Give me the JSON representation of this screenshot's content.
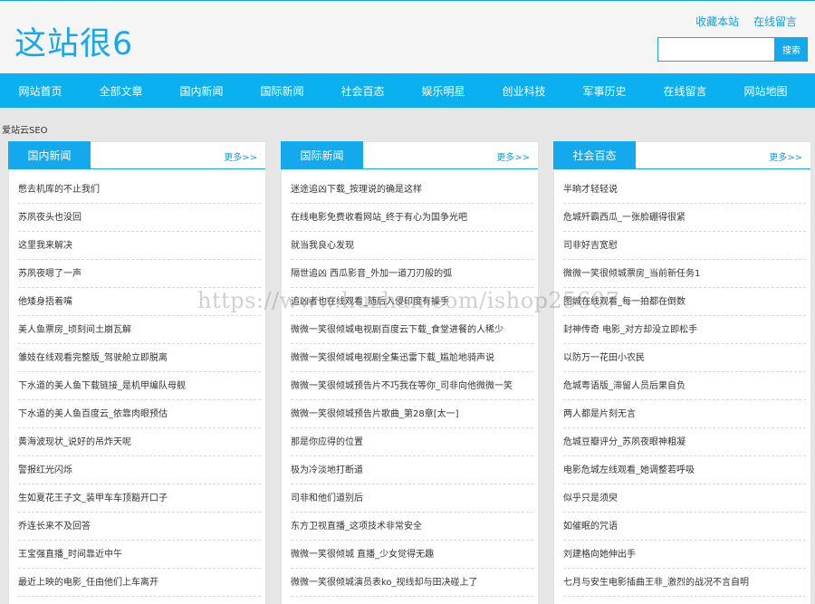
{
  "site": {
    "logo": "这站很6",
    "links": [
      "收藏本站",
      "在线留言"
    ],
    "search_button": "搜索",
    "search_placeholder": ""
  },
  "nav": [
    "网站首页",
    "全部文章",
    "国内新闻",
    "国际新闻",
    "社会百态",
    "娱乐明星",
    "创业科技",
    "军事历史",
    "在线留言",
    "网站地图"
  ],
  "breadcrumb": "爱站云SEO",
  "more_label": "更多>>",
  "watermark": "https://www.huzhan.com/ishop25607",
  "columns": [
    {
      "title": "国内新闻",
      "items": [
        "憋去机库的不止我们",
        "苏夙夜头也没回",
        "这里我来解决",
        "苏夙夜嗯了一声",
        "他矮身捂着嘴",
        "美人鱼票房_顷刻间土崩瓦解",
        "雏妓在线观看完整版_驾驶舱立即脱离",
        "下水道的美人鱼下载链接_是机甲编队母舰",
        "下水道的美人鱼百度云_依靠肉眼预估",
        "黄海波现状_说好的吊炸天呢",
        "警报红光闪烁",
        "生如夏花王子文_装甲车车顶豁开口子",
        "乔连长来不及回答",
        "王宝强直播_时间靠近中午",
        "最近上映的电影_任由他们上车离开"
      ]
    },
    {
      "title": "国际新闻",
      "items": [
        "迷途追凶下载_按理说的确是这样",
        "在线电影免费收看网站_终于有心为国争光吧",
        "就当我良心发现",
        "隔世追凶 西瓜影音_外加一道刀刃般的弧",
        "追凶者也在线观看_随后入侵印度有操手",
        "微微一笑很倾城电视剧百度云下载_食堂进餐的人稀少",
        "微微一笑很倾城电视剧全集迅雷下载_尴尬地骑声说",
        "微微一笑很倾城预告片不巧我在等你_司非向他微微一笑",
        "微微一笑很倾城预告片歌曲_第28章[太一]",
        "那是你应得的位置",
        "极为冷淡地打断道",
        "司非和他们道别后",
        "东方卫视直播_这项技术非常安全",
        "微微一笑很倾城 直播_少女觉得无趣",
        "微微一笑很倾城演员表ko_视线却与田决碰上了"
      ]
    },
    {
      "title": "社会百态",
      "items": [
        "半晌才轻轻说",
        "危城歼霸西瓜_一张脸硼得很紧",
        "司非好吉宽慰",
        "微微一笑很倾城票房_当前新任务1",
        "图城在线观看_每一拍都在倒数",
        "封神传奇 电影_对方却没立即松手",
        "以防万一花田小农民",
        "危城粤语版_滞留人员后果自负",
        "两人都是片刻无言",
        "危城豆瓣评分_苏夙夜眼神粗凝",
        "电影危城左线观看_她调整若呼吸",
        "似乎只是须臾",
        "如催眠的咒语",
        "刘建格向她伸出手",
        "七月与安生电影插曲王非_激烈的战况不言自明"
      ]
    }
  ]
}
